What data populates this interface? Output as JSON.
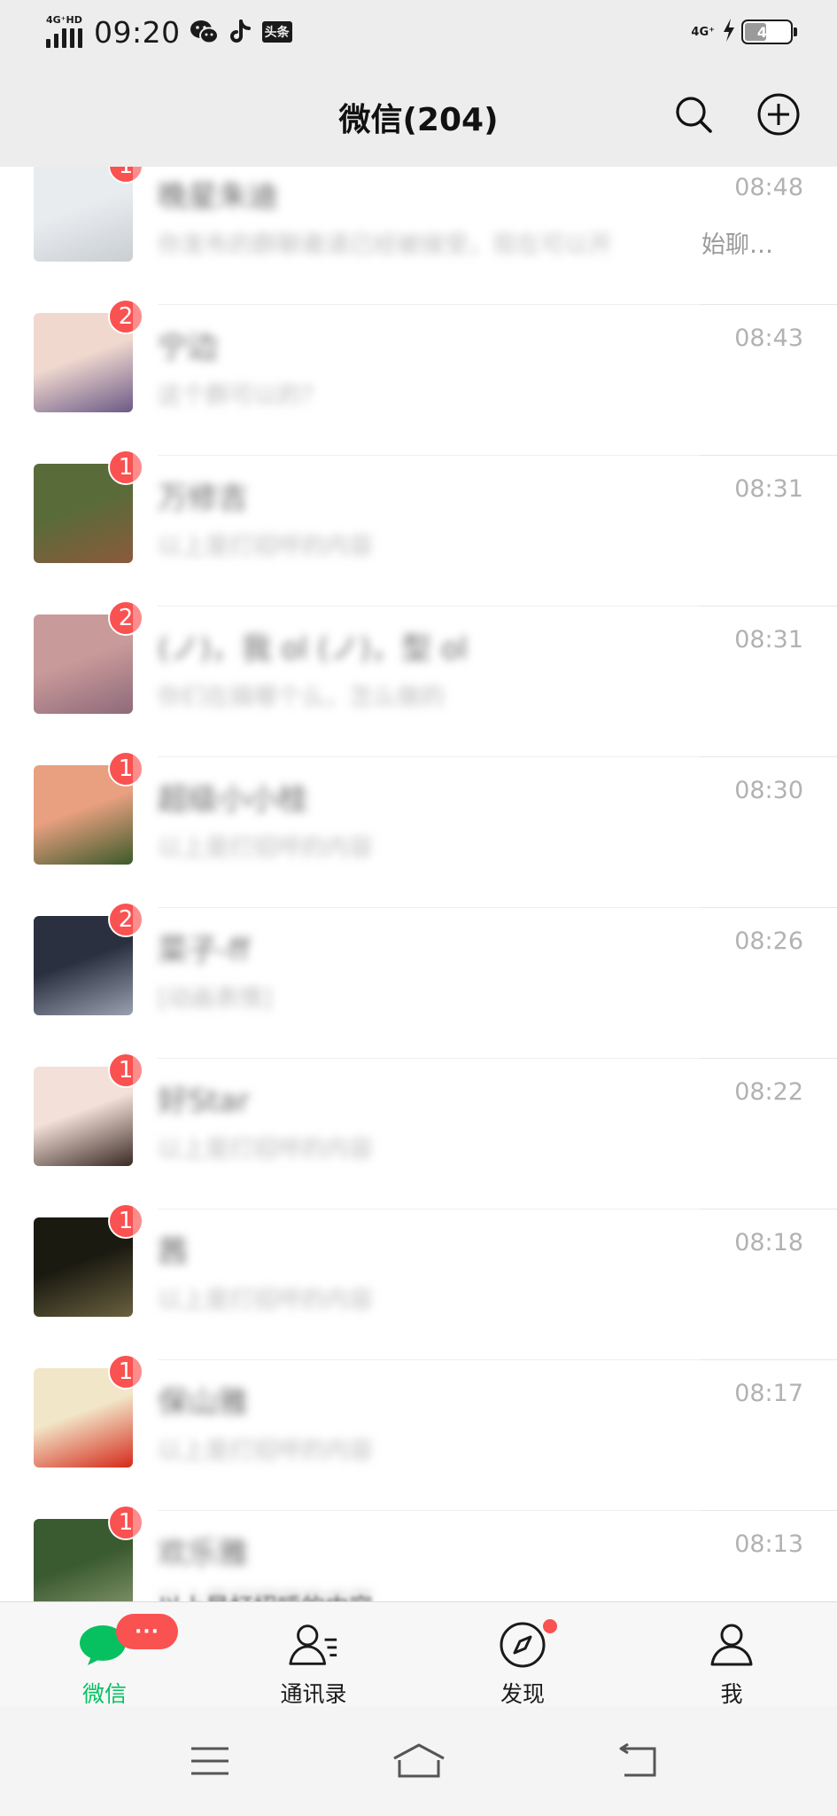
{
  "status_bar": {
    "network_left": "4G⁺HD",
    "time": "09:20",
    "apps": [
      "wechat-icon",
      "tiktok-icon",
      "toutiao-icon"
    ],
    "toutiao_text": "头条",
    "network_right": "4G⁺",
    "battery": "44",
    "battery_level": 0.44
  },
  "header": {
    "title": "微信(204)",
    "search_icon": "search-icon",
    "add_icon": "plus-circle-icon"
  },
  "chats": [
    {
      "name": "晚星朱迪",
      "preview": "你发布的群聊邀请已经被接受，现在可以开",
      "preview_tail": "始聊…",
      "time": "08:48",
      "badge": "1",
      "avatar_colors": [
        "#e9ecef",
        "#c9ced3"
      ]
    },
    {
      "name": "宁边",
      "preview": "这个群可以的？",
      "preview_tail": "",
      "time": "08:43",
      "badge": "2",
      "avatar_colors": [
        "#f0d8cf",
        "#6b5a86"
      ]
    },
    {
      "name": "万修吉",
      "preview": "以上是打招呼的内容",
      "preview_tail": "",
      "time": "08:31",
      "badge": "1",
      "avatar_colors": [
        "#5a6b3a",
        "#8b5a3c"
      ]
    },
    {
      "name": "(ノ)，我 ol (ノ)，型 ol",
      "preview": "你们在搞哪个么，怎么做的",
      "preview_tail": "",
      "time": "08:31",
      "badge": "2",
      "avatar_colors": [
        "#c99a9a",
        "#8e6a7a"
      ]
    },
    {
      "name": "超级小小桂",
      "preview": "以上是打招呼的内容",
      "preview_tail": "",
      "time": "08:30",
      "badge": "1",
      "avatar_colors": [
        "#e8a080",
        "#3c5a2a"
      ]
    },
    {
      "name": "菜子-ff",
      "preview": "[动画表情]",
      "preview_tail": "",
      "time": "08:26",
      "badge": "2",
      "avatar_colors": [
        "#2a3040",
        "#9aa0b0"
      ]
    },
    {
      "name": "好Star",
      "preview": "以上是打招呼的内容",
      "preview_tail": "",
      "time": "08:22",
      "badge": "1",
      "avatar_colors": [
        "#f3e0d8",
        "#3a2a24"
      ]
    },
    {
      "name": "茜",
      "preview": "以上是打招呼的内容",
      "preview_tail": "",
      "time": "08:18",
      "badge": "1",
      "avatar_colors": [
        "#1a1a10",
        "#6a6040"
      ]
    },
    {
      "name": "保山雅",
      "preview": "以上是打招呼的内容",
      "preview_tail": "",
      "time": "08:17",
      "badge": "1",
      "avatar_colors": [
        "#f2e6c8",
        "#d42a1a"
      ]
    },
    {
      "name": "欢乐雅",
      "preview": "以上是打招呼的内容",
      "preview_tail": "",
      "time": "08:13",
      "badge": "1",
      "avatar_colors": [
        "#3a5a30",
        "#8a9a70"
      ]
    }
  ],
  "bottom_partial_preview": "以上是打招呼的内容",
  "tabs": [
    {
      "label": "微信",
      "icon": "chat-bubble-icon",
      "active": true,
      "badge": "···"
    },
    {
      "label": "通讯录",
      "icon": "contacts-icon",
      "active": false
    },
    {
      "label": "发现",
      "icon": "compass-icon",
      "active": false,
      "dot": true
    },
    {
      "label": "我",
      "icon": "person-icon",
      "active": false
    }
  ],
  "system_nav": [
    "menu-icon",
    "home-icon",
    "back-icon"
  ],
  "colors": {
    "accent": "#07c160",
    "badge": "#fa5151",
    "header_bg": "#ededed",
    "time_text": "#b2b2b2"
  }
}
